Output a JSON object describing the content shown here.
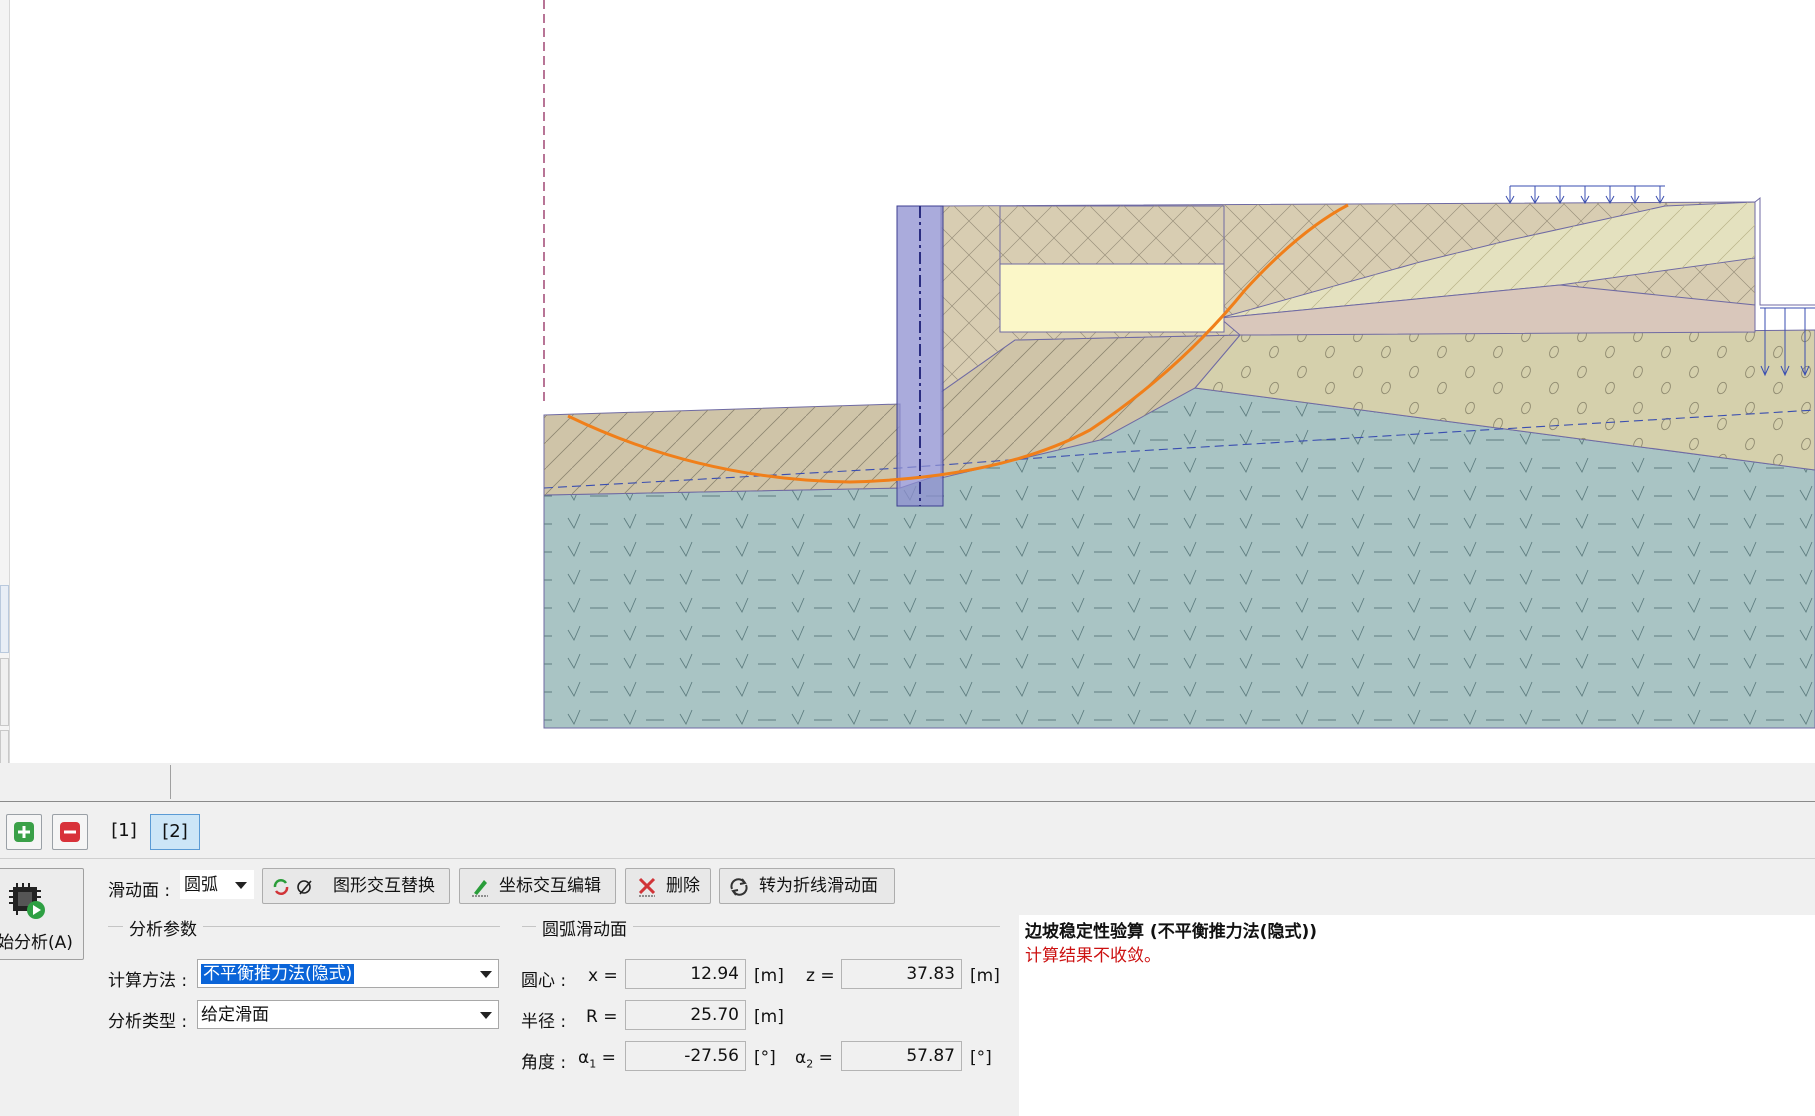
{
  "stage_tabs": [
    "[1]",
    "[2]"
  ],
  "active_stage": "[2]",
  "analyze_button": {
    "label": "始分析(A)"
  },
  "toolbar": {
    "slip_surface_label": "滑动面 :",
    "slip_surface_value": "圆弧",
    "graphic_replace": "图形交互替换",
    "coord_edit": "坐标交互编辑",
    "delete": "删除",
    "convert_polyline": "转为折线滑动面"
  },
  "analysis_params": {
    "title": "分析参数",
    "method_label": "计算方法 :",
    "method_value": "不平衡推力法(隐式)",
    "type_label": "分析类型 :",
    "type_value": "给定滑面"
  },
  "circle": {
    "title": "圆弧滑动面",
    "center_label": "圆心 :",
    "x_label": "x =",
    "x_value": "12.94",
    "x_unit": "[m]",
    "z_label": "z =",
    "z_value": "37.83",
    "z_unit": "[m]",
    "radius_label": "半径 :",
    "r_label": "R =",
    "r_value": "25.70",
    "r_unit": "[m]",
    "angle_label": "角度 :",
    "a1_label": "α",
    "a1_sub": "1",
    "a1_eq": "=",
    "a1_value": "-27.56",
    "a1_unit": "[°]",
    "a2_label": "α",
    "a2_sub": "2",
    "a2_eq": "=",
    "a2_value": "57.87",
    "a2_unit": "[°]"
  },
  "results": {
    "title": "边坡稳定性验算 (不平衡推力法(隐式))",
    "message": "计算结果不收敛。"
  },
  "colors": {
    "soil_top": "#d8cdb2",
    "soil_clay": "#cfc4a8",
    "soil_gravel": "#d5d0ac",
    "soil_rock": "#a9c4c4",
    "slip_arc": "#f07f1a",
    "pile": "#8d8fd0",
    "fill_yellow": "#fbf7c8",
    "error_text": "#cc1111"
  }
}
